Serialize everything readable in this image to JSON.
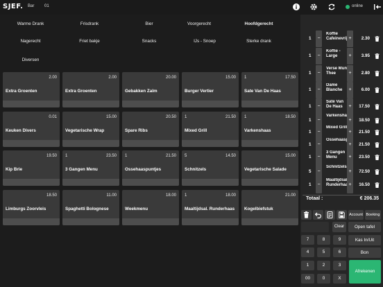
{
  "header": {
    "logo": "SJEF.",
    "location": "Bar",
    "table": "01",
    "status": "online",
    "icons": [
      "info-icon",
      "gear-icon",
      "refresh-icon",
      "logout-icon"
    ],
    "status_color": "#2bb673"
  },
  "categories": [
    {
      "label": "Warme Drank",
      "active": false
    },
    {
      "label": "Frisdrank",
      "active": false
    },
    {
      "label": "Bier",
      "active": false
    },
    {
      "label": "Voorgerecht",
      "active": false
    },
    {
      "label": "Hoofdgerecht",
      "active": true
    },
    {
      "label": "Nagerecht",
      "active": false
    },
    {
      "label": "Friet bakje",
      "active": false
    },
    {
      "label": "Snacks",
      "active": false
    },
    {
      "label": "IJs - Snoep",
      "active": false
    },
    {
      "label": "Sterke drank",
      "active": false
    },
    {
      "label": "Diversen",
      "active": false
    }
  ],
  "products": [
    {
      "name": "Extra Groenten",
      "qty": "",
      "price": "2.00"
    },
    {
      "name": "Extra Groenten",
      "qty": "",
      "price": "2.00"
    },
    {
      "name": "Gebakken Zalm",
      "qty": "",
      "price": "20.00"
    },
    {
      "name": "Burger Vertier",
      "qty": "",
      "price": "15.00"
    },
    {
      "name": "Sate Van De Haas",
      "qty": "1",
      "price": "17.50"
    },
    {
      "name": "Keuken Divers",
      "qty": "",
      "price": "0.01"
    },
    {
      "name": "Vegetarische Wrap",
      "qty": "",
      "price": "15.00"
    },
    {
      "name": "Spare Ribs",
      "qty": "",
      "price": "20.50"
    },
    {
      "name": "Mixed Grill",
      "qty": "1",
      "price": "21.50"
    },
    {
      "name": "Varkenshaas",
      "qty": "1",
      "price": "18.50"
    },
    {
      "name": "Kip Brie",
      "qty": "",
      "price": "19.50"
    },
    {
      "name": "3 Gangen Menu",
      "qty": "1",
      "price": "23.50"
    },
    {
      "name": "Ossehaaspuntjes",
      "qty": "1",
      "price": "21.50"
    },
    {
      "name": "Schnitzels",
      "qty": "5",
      "price": "14.50"
    },
    {
      "name": "Vegetarische Salade",
      "qty": "",
      "price": "15.00"
    },
    {
      "name": "Limburgs Zoorvleis",
      "qty": "",
      "price": "18.50"
    },
    {
      "name": "Spaghetti Bolognese",
      "qty": "",
      "price": "11.00"
    },
    {
      "name": "Weekmenu",
      "qty": "",
      "price": "18.00"
    },
    {
      "name": "Maaltijdsal. Runderhaas",
      "qty": "1",
      "price": "18.00"
    },
    {
      "name": "Kogelbiefstuk",
      "qty": "",
      "price": "21.00"
    }
  ],
  "order": [
    {
      "qty": "1",
      "name": "Koffie Cafeinevrij",
      "price": "2.30"
    },
    {
      "qty": "1",
      "name": "Koffie - Large",
      "price": "3.95"
    },
    {
      "qty": "1",
      "name": "Verse Munt Thee",
      "price": "2.80"
    },
    {
      "qty": "1",
      "name": "Dame Blanche",
      "price": "6.00"
    },
    {
      "qty": "1",
      "name": "Sate Van De Haas",
      "price": "17.50"
    },
    {
      "qty": "1",
      "name": "Varkenshaas",
      "price": "18.50"
    },
    {
      "qty": "1",
      "name": "Mixed Grill",
      "price": "21.50"
    },
    {
      "qty": "1",
      "name": "Ossehaaspuntjes",
      "price": "21.50"
    },
    {
      "qty": "1",
      "name": "3 Gangen Menu",
      "price": "23.50"
    },
    {
      "qty": "5",
      "name": "Schnitzels",
      "price": "72.50"
    },
    {
      "qty": "1",
      "name": "Maaltijdsal. Runderhaas",
      "price": "16.50"
    }
  ],
  "order_controls": {
    "minus": "−",
    "plus": "+"
  },
  "total": {
    "label": "Totaal :",
    "value": "€ 206.35"
  },
  "actions": {
    "icons": [
      "trash-icon",
      "undo-icon",
      "receipt-icon",
      "save-icon"
    ],
    "account": "Account",
    "boeking": "Boeking"
  },
  "keypad": {
    "clear": "Clear",
    "open_tafel": "Open tafel",
    "kas": "Kas In/Uit",
    "bon": "Bon",
    "afrekenen": "Afrekenen",
    "keys": [
      "7",
      "8",
      "9",
      "4",
      "5",
      "6",
      "1",
      "2",
      "3",
      "00",
      "0",
      "X"
    ]
  },
  "accent_color": "#2bb673"
}
